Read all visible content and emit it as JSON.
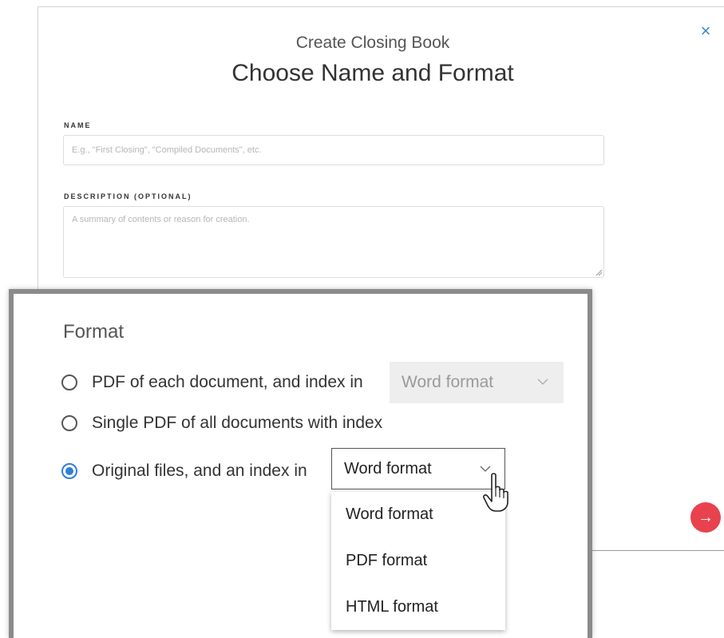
{
  "dialog": {
    "subtitle": "Create Closing Book",
    "title": "Choose Name and Format",
    "close_icon": "×",
    "name_label": "NAME",
    "name_placeholder": "E.g., \"First Closing\", \"Compiled Documents\", etc.",
    "description_label": "DESCRIPTION (OPTIONAL)",
    "description_placeholder": "A summary of contents or reason for creation.",
    "next_icon": "→"
  },
  "format": {
    "heading": "Format",
    "options": [
      {
        "label": "PDF of each document, and index in",
        "selected": false
      },
      {
        "label": "Single PDF of all documents with index",
        "selected": false
      },
      {
        "label": "Original files, and an index in",
        "selected": true
      }
    ],
    "index_select_1": {
      "value": "Word format",
      "disabled": true
    },
    "index_select_2": {
      "value": "Word format",
      "disabled": false,
      "open": true
    },
    "dropdown_options": [
      "Word format",
      "PDF format",
      "HTML format"
    ]
  },
  "colors": {
    "accent": "#2f7fd6",
    "close": "#3d86c6",
    "next_button": "#e8424f",
    "zoom_border": "#8b8b8b"
  },
  "icons": [
    "close-icon",
    "chevron-down-icon",
    "arrow-right-icon",
    "hand-pointer-cursor"
  ]
}
